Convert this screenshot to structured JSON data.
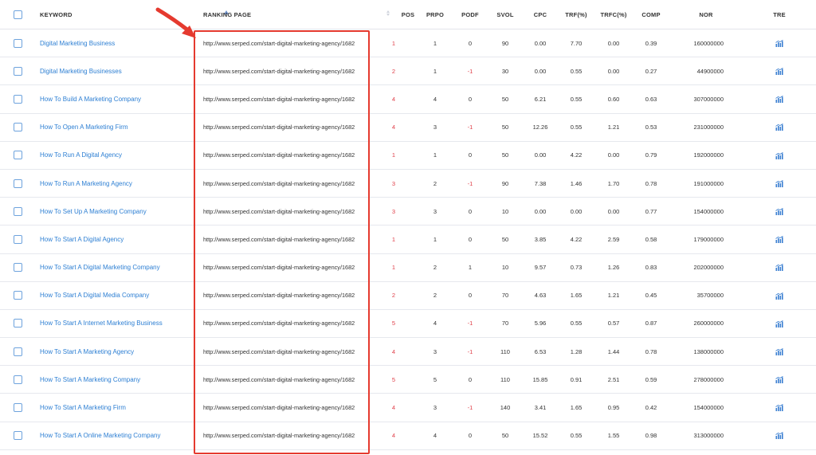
{
  "header": {
    "keyword": "KEYWORD",
    "ranking_page": "RANKING PAGE",
    "pos": "POS",
    "prpo": "PRPO",
    "podf": "PODF",
    "svol": "SVOL",
    "cpc": "CPC",
    "trf": "TRF(%)",
    "trfc": "TRFC(%)",
    "comp": "COMP",
    "nor": "NOR",
    "tre": "TRE"
  },
  "icons": {
    "trend": "trend-chart-icon",
    "sort": "sort-arrows-icon",
    "annotation": "red-arrow-and-highlight-box"
  },
  "colors": {
    "link": "#2d7fd3",
    "negative": "#e0404a",
    "highlight": "#e53a2f"
  },
  "rows": [
    {
      "keyword": "Digital Marketing Business",
      "page": "http://www.serped.com/start-digital-marketing-agency/1682",
      "pos": "1",
      "prpo": "1",
      "podf": "0",
      "svol": "90",
      "cpc": "0.00",
      "trf": "7.70",
      "trfc": "0.00",
      "comp": "0.39",
      "nor": "160000000"
    },
    {
      "keyword": "Digital Marketing Businesses",
      "page": "http://www.serped.com/start-digital-marketing-agency/1682",
      "pos": "2",
      "prpo": "1",
      "podf": "-1",
      "svol": "30",
      "cpc": "0.00",
      "trf": "0.55",
      "trfc": "0.00",
      "comp": "0.27",
      "nor": "44900000"
    },
    {
      "keyword": "How To Build A Marketing Company",
      "page": "http://www.serped.com/start-digital-marketing-agency/1682",
      "pos": "4",
      "prpo": "4",
      "podf": "0",
      "svol": "50",
      "cpc": "6.21",
      "trf": "0.55",
      "trfc": "0.60",
      "comp": "0.63",
      "nor": "307000000"
    },
    {
      "keyword": "How To Open A Marketing Firm",
      "page": "http://www.serped.com/start-digital-marketing-agency/1682",
      "pos": "4",
      "prpo": "3",
      "podf": "-1",
      "svol": "50",
      "cpc": "12.26",
      "trf": "0.55",
      "trfc": "1.21",
      "comp": "0.53",
      "nor": "231000000"
    },
    {
      "keyword": "How To Run A Digital Agency",
      "page": "http://www.serped.com/start-digital-marketing-agency/1682",
      "pos": "1",
      "prpo": "1",
      "podf": "0",
      "svol": "50",
      "cpc": "0.00",
      "trf": "4.22",
      "trfc": "0.00",
      "comp": "0.79",
      "nor": "192000000"
    },
    {
      "keyword": "How To Run A Marketing Agency",
      "page": "http://www.serped.com/start-digital-marketing-agency/1682",
      "pos": "3",
      "prpo": "2",
      "podf": "-1",
      "svol": "90",
      "cpc": "7.38",
      "trf": "1.46",
      "trfc": "1.70",
      "comp": "0.78",
      "nor": "191000000"
    },
    {
      "keyword": "How To Set Up A Marketing Company",
      "page": "http://www.serped.com/start-digital-marketing-agency/1682",
      "pos": "3",
      "prpo": "3",
      "podf": "0",
      "svol": "10",
      "cpc": "0.00",
      "trf": "0.00",
      "trfc": "0.00",
      "comp": "0.77",
      "nor": "154000000"
    },
    {
      "keyword": "How To Start A Digital Agency",
      "page": "http://www.serped.com/start-digital-marketing-agency/1682",
      "pos": "1",
      "prpo": "1",
      "podf": "0",
      "svol": "50",
      "cpc": "3.85",
      "trf": "4.22",
      "trfc": "2.59",
      "comp": "0.58",
      "nor": "179000000"
    },
    {
      "keyword": "How To Start A Digital Marketing Company",
      "page": "http://www.serped.com/start-digital-marketing-agency/1682",
      "pos": "1",
      "prpo": "2",
      "podf": "1",
      "svol": "10",
      "cpc": "9.57",
      "trf": "0.73",
      "trfc": "1.26",
      "comp": "0.83",
      "nor": "202000000"
    },
    {
      "keyword": "How To Start A Digital Media Company",
      "page": "http://www.serped.com/start-digital-marketing-agency/1682",
      "pos": "2",
      "prpo": "2",
      "podf": "0",
      "svol": "70",
      "cpc": "4.63",
      "trf": "1.65",
      "trfc": "1.21",
      "comp": "0.45",
      "nor": "35700000"
    },
    {
      "keyword": "How To Start A Internet Marketing Business",
      "page": "http://www.serped.com/start-digital-marketing-agency/1682",
      "pos": "5",
      "prpo": "4",
      "podf": "-1",
      "svol": "70",
      "cpc": "5.96",
      "trf": "0.55",
      "trfc": "0.57",
      "comp": "0.87",
      "nor": "260000000"
    },
    {
      "keyword": "How To Start A Marketing Agency",
      "page": "http://www.serped.com/start-digital-marketing-agency/1682",
      "pos": "4",
      "prpo": "3",
      "podf": "-1",
      "svol": "110",
      "cpc": "6.53",
      "trf": "1.28",
      "trfc": "1.44",
      "comp": "0.78",
      "nor": "138000000"
    },
    {
      "keyword": "How To Start A Marketing Company",
      "page": "http://www.serped.com/start-digital-marketing-agency/1682",
      "pos": "5",
      "prpo": "5",
      "podf": "0",
      "svol": "110",
      "cpc": "15.85",
      "trf": "0.91",
      "trfc": "2.51",
      "comp": "0.59",
      "nor": "278000000"
    },
    {
      "keyword": "How To Start A Marketing Firm",
      "page": "http://www.serped.com/start-digital-marketing-agency/1682",
      "pos": "4",
      "prpo": "3",
      "podf": "-1",
      "svol": "140",
      "cpc": "3.41",
      "trf": "1.65",
      "trfc": "0.95",
      "comp": "0.42",
      "nor": "154000000"
    },
    {
      "keyword": "How To Start A Online Marketing Company",
      "page": "http://www.serped.com/start-digital-marketing-agency/1682",
      "pos": "4",
      "prpo": "4",
      "podf": "0",
      "svol": "50",
      "cpc": "15.52",
      "trf": "0.55",
      "trfc": "1.55",
      "comp": "0.98",
      "nor": "313000000"
    }
  ]
}
